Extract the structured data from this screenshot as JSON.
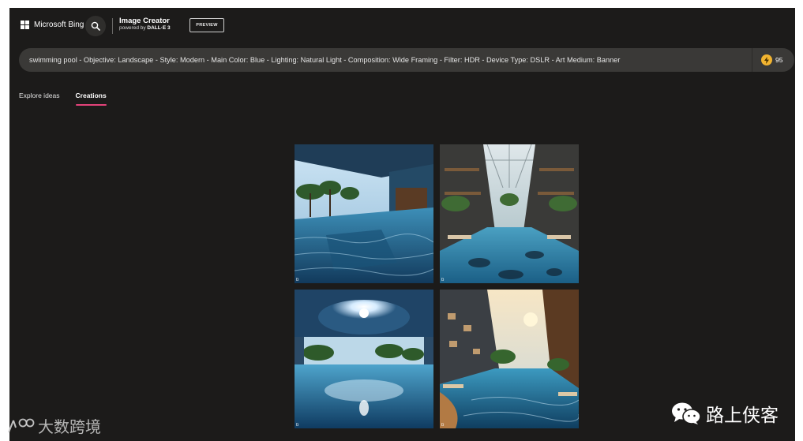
{
  "header": {
    "brand": "Microsoft Bing",
    "creator_title": "Image Creator",
    "creator_sub_prefix": "powered by",
    "creator_sub_model": "DALL·E 3",
    "preview_label": "PREVIEW",
    "icons": {
      "logo": "microsoft-logo-icon",
      "search": "search-icon"
    }
  },
  "prompt": {
    "value": "swimming pool - Objective: Landscape - Style: Modern - Main Color: Blue - Lighting: Natural Light - Composition: Wide Framing - Filter: HDR - Device Type: DSLR - Art Medium: Banner",
    "boost_count": "95",
    "boost_icon": "boost-coin-icon"
  },
  "tabs": [
    {
      "label": "Explore ideas",
      "active": false
    },
    {
      "label": "Creations",
      "active": true
    }
  ],
  "images": [
    {
      "badge": "b"
    },
    {
      "badge": "b"
    },
    {
      "badge": "b"
    },
    {
      "badge": "b"
    }
  ],
  "watermarks": {
    "left": "大数跨境",
    "right": "路上侠客"
  },
  "colors": {
    "background": "#1c1b1a",
    "prompt_bar": "#3a3937",
    "tab_underline": "#e3437a",
    "coin": "#f2b430"
  }
}
